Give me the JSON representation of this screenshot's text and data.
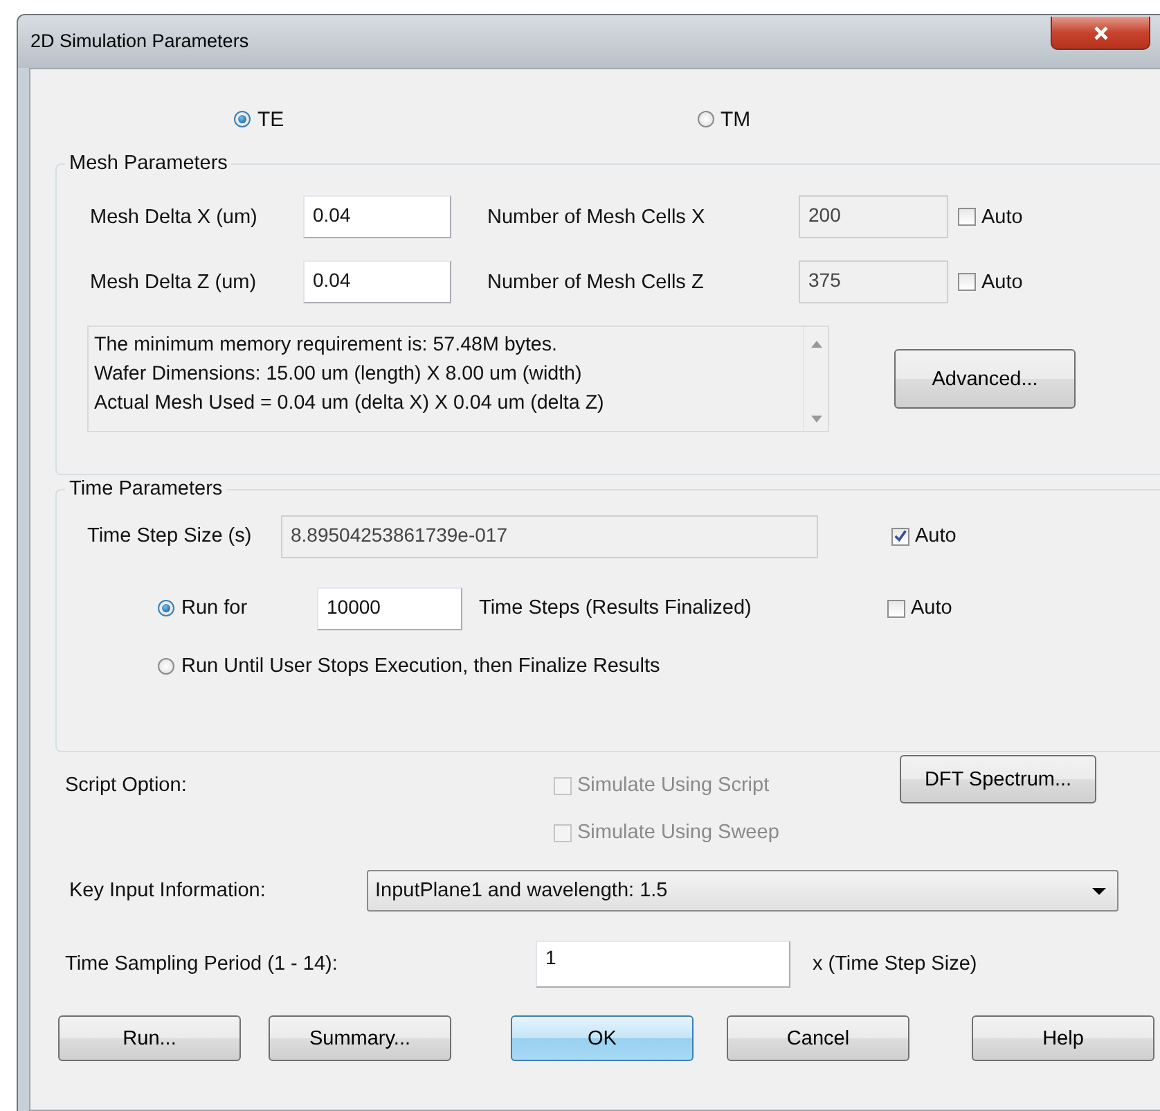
{
  "window": {
    "title": "2D Simulation Parameters"
  },
  "polarization": [
    {
      "label": "TE",
      "selected": true
    },
    {
      "label": "TM",
      "selected": false
    }
  ],
  "mesh": {
    "title": "Mesh Parameters",
    "rows": [
      {
        "label": "Mesh Delta X (um)",
        "value": "0.04",
        "cells_label": "Number of Mesh Cells X",
        "cells": "200",
        "auto_label": "Auto",
        "auto": false
      },
      {
        "label": "Mesh Delta Z (um)",
        "value": "0.04",
        "cells_label": "Number of Mesh Cells Z",
        "cells": "375",
        "auto_label": "Auto",
        "auto": false
      }
    ],
    "info": [
      "The minimum memory requirement is: 57.48M bytes.",
      "Wafer Dimensions: 15.00 um (length) X 8.00 um (width)",
      "Actual Mesh Used = 0.04 um (delta X) X 0.04 um (delta Z)"
    ],
    "advanced": "Advanced..."
  },
  "time": {
    "title": "Time Parameters",
    "step_label": "Time Step Size (s)",
    "step_value": "8.89504253861739e-017",
    "step_disabled": true,
    "step_auto": {
      "label": "Auto",
      "checked": true
    },
    "modes": [
      {
        "label": "Run for",
        "selected": true,
        "value": "10000",
        "suffix": "Time Steps (Results Finalized)",
        "auto": {
          "label": "Auto",
          "checked": false
        }
      },
      {
        "label": "Run Until User Stops Execution, then Finalize Results",
        "selected": false
      }
    ]
  },
  "script": {
    "label": "Script Option:",
    "options": [
      {
        "label": "Simulate Using Script",
        "checked": false,
        "disabled": true
      },
      {
        "label": "Simulate Using Sweep",
        "checked": false,
        "disabled": true
      }
    ],
    "dft": "DFT Spectrum..."
  },
  "key_input": {
    "label": "Key Input Information:",
    "value": "InputPlane1 and wavelength: 1.5"
  },
  "sampling": {
    "label": "Time Sampling Period (1 - 14):",
    "value": "1",
    "suffix": "x (Time Step Size)"
  },
  "buttons": [
    {
      "label": "Run...",
      "default": false
    },
    {
      "label": "Summary...",
      "default": false
    },
    {
      "label": "OK",
      "default": true
    },
    {
      "label": "Cancel",
      "default": false
    },
    {
      "label": "Help",
      "default": false
    }
  ]
}
